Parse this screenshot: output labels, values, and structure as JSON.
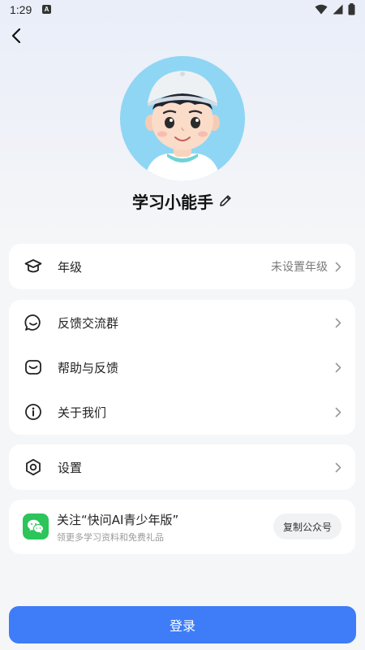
{
  "status_bar": {
    "time": "1:29",
    "notif_letter": "A"
  },
  "profile": {
    "name": "学习小能手"
  },
  "menu": {
    "grade": {
      "label": "年级",
      "value": "未设置年级"
    },
    "feedback_group": {
      "label": "反馈交流群"
    },
    "help": {
      "label": "帮助与反馈"
    },
    "about": {
      "label": "关于我们"
    },
    "settings": {
      "label": "设置"
    }
  },
  "follow": {
    "title": "关注“快问AI青少年版”",
    "subtitle": "领更多学习资料和免费礼品",
    "copy_button": "复制公众号"
  },
  "login_button": "登录",
  "colors": {
    "accent": "#3e7cf8",
    "wechat": "#2bc55a",
    "avatar_bg": "#8fd6f4"
  }
}
